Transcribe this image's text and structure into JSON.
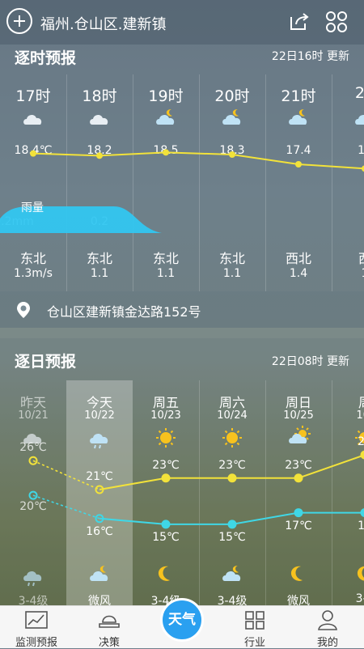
{
  "header": {
    "location": "福州.仓山区.建新镇"
  },
  "hourly": {
    "title": "逐时预报",
    "updated": "22日16时 更新",
    "rain_label": "雨量",
    "items": [
      {
        "hour": "17时",
        "temp": "18.4℃",
        "rain": "0.2mm",
        "wind_dir": "东北",
        "wind_speed": "1.3m/s",
        "icon": "cloud-icon"
      },
      {
        "hour": "18时",
        "temp": "18.2",
        "rain": "0.2",
        "wind_dir": "东北",
        "wind_speed": "1.1",
        "icon": "cloud-icon"
      },
      {
        "hour": "19时",
        "temp": "18.5",
        "rain": "",
        "wind_dir": "东北",
        "wind_speed": "1.1",
        "icon": "cloud-moon-icon"
      },
      {
        "hour": "20时",
        "temp": "18.3",
        "rain": "",
        "wind_dir": "东北",
        "wind_speed": "1.1",
        "icon": "cloud-moon-icon"
      },
      {
        "hour": "21时",
        "temp": "17.4",
        "rain": "",
        "wind_dir": "西北",
        "wind_speed": "1.4",
        "icon": "cloud-moon-icon"
      },
      {
        "hour": "22",
        "temp": "17",
        "rain": "",
        "wind_dir": "西",
        "wind_speed": "1",
        "icon": "cloud-moon-icon"
      }
    ]
  },
  "address": "仓山区建新镇金达路152号",
  "daily": {
    "title": "逐日预报",
    "updated": "22日08时 更新",
    "items": [
      {
        "day": "昨天",
        "date": "10/21",
        "icon": "cloud-icon",
        "high": "26℃",
        "low": "20℃",
        "night_icon": "cloud-rain-icon",
        "wind": "3-4级"
      },
      {
        "day": "今天",
        "date": "10/22",
        "icon": "cloud-rain-icon",
        "high": "21℃",
        "low": "16℃",
        "night_icon": "cloud-moon-icon",
        "wind": "微风"
      },
      {
        "day": "周五",
        "date": "10/23",
        "icon": "sun-icon",
        "high": "23℃",
        "low": "15℃",
        "night_icon": "moon-icon",
        "wind": "3-4级"
      },
      {
        "day": "周六",
        "date": "10/24",
        "icon": "sun-icon",
        "high": "23℃",
        "low": "15℃",
        "night_icon": "cloud-moon-icon",
        "wind": "3-4级"
      },
      {
        "day": "周日",
        "date": "10/25",
        "icon": "cloud-sun-icon",
        "high": "23℃",
        "low": "17℃",
        "night_icon": "moon-icon",
        "wind": "微风"
      },
      {
        "day": "周",
        "date": "10/",
        "icon": "sun-icon",
        "high": "27",
        "low": "17",
        "night_icon": "moon-icon",
        "wind": "3-4"
      }
    ]
  },
  "nav": {
    "items": [
      {
        "label": "监测预报",
        "icon": "chart-icon"
      },
      {
        "label": "决策",
        "icon": "hat-icon"
      },
      {
        "label": "天气",
        "icon": "weather-icon"
      },
      {
        "label": "行业",
        "icon": "grid-icon"
      },
      {
        "label": "我的",
        "icon": "person-icon"
      }
    ]
  },
  "colors": {
    "temp_line": "#f2e23a",
    "low_line": "#3fd7e6",
    "rain_fill": "#32c6f0",
    "nav_active": "#2aa0f0"
  }
}
